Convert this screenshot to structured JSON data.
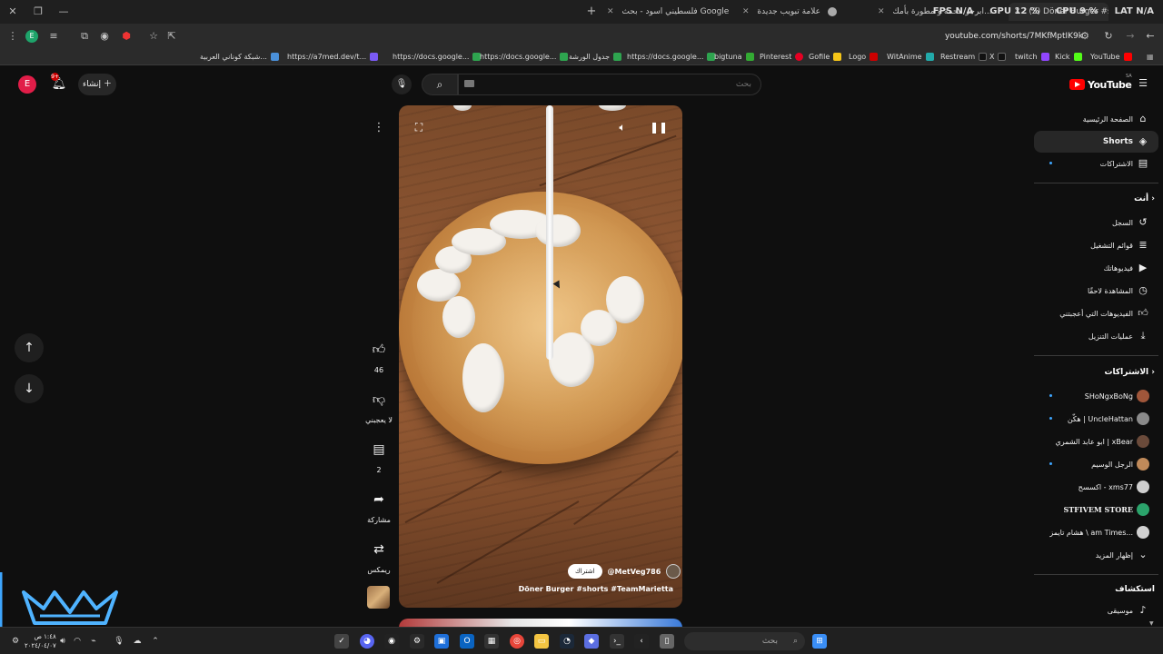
{
  "browser": {
    "tabs": [
      {
        "label": "فلسطيني اسود - بحث Google"
      },
      {
        "label": "علامة تبويب جديدة"
      },
      {
        "label": "ابرجر محمة و مطورة بأمك..."
      },
      {
        "label": "(3) Döner Burger #shorts #..."
      }
    ],
    "stats": {
      "fps": "FPS  N/A",
      "gpu": "GPU  12 %",
      "cpu": "CPU  9 %",
      "lat": "LAT  N/A"
    },
    "url": "youtube.com/shorts/7MKfMptIK9k",
    "bookmarks": [
      {
        "label": "شبكة كوناني العربية...",
        "color": "#4a90d9"
      },
      {
        "label": "https://a7med.dev/t...",
        "color": "#e44"
      },
      {
        "label": "https://docs.google...",
        "color": "#2ea44f"
      },
      {
        "label": "https://docs.google...",
        "color": "#2ea44f"
      },
      {
        "label": "جدول الورشة",
        "color": "#2ea44f"
      },
      {
        "label": "https://docs.google...",
        "color": "#2ea44f"
      },
      {
        "label": "bigtuna",
        "color": "#2ea44f"
      },
      {
        "label": "Pinterest",
        "color": "#9aa"
      },
      {
        "label": "Gofile",
        "color": "#e60023"
      },
      {
        "label": "Logo",
        "color": "#f5c518"
      },
      {
        "label": "WitAnime",
        "color": "#c00"
      },
      {
        "label": "Restream",
        "color": "#2aa"
      },
      {
        "label": "X",
        "color": "#111"
      },
      {
        "label": "twitch",
        "color": "#ddd"
      },
      {
        "label": "Kick",
        "color": "#9146ff"
      },
      {
        "label": "YouTube",
        "color": "#53fc18"
      }
    ]
  },
  "header": {
    "avatar_letter": "E",
    "notification_count": "9+",
    "create_label": "إنشاء",
    "search_placeholder": "بحث",
    "logo_text": "YouTube",
    "logo_region": "SA"
  },
  "sidebar": {
    "main": [
      {
        "label": "الصفحة الرئيسية",
        "icon": "home-icon"
      },
      {
        "label": "Shorts",
        "icon": "shorts-icon"
      },
      {
        "label": "الاشتراكات",
        "icon": "subscriptions-icon"
      }
    ],
    "you_header": "أنت",
    "you": [
      {
        "label": "السجل",
        "icon": "history-icon"
      },
      {
        "label": "قوائم التشغيل",
        "icon": "playlists-icon"
      },
      {
        "label": "فيديوهاتك",
        "icon": "your-videos-icon"
      },
      {
        "label": "المشاهدة لاحقًا",
        "icon": "watch-later-icon"
      },
      {
        "label": "الفيديوهات التي أعجبتني",
        "icon": "liked-icon"
      },
      {
        "label": "عمليات التنزيل",
        "icon": "download-icon"
      }
    ],
    "subs_header": "الاشتراكات",
    "subs": [
      {
        "label": "SHoNgxBoNg",
        "avatar": "#a0563a"
      },
      {
        "label": "هكّن | UncleHattan",
        "avatar": "#8a8a8a"
      },
      {
        "label": "ابو عابد الشمري | xBear",
        "avatar": "#6a4a3a"
      },
      {
        "label": "الرجل الوسيم",
        "avatar": "#c08a5a"
      },
      {
        "label": "اكسسح - xms77",
        "avatar": "#cfcfcf"
      },
      {
        "label": "STFIVEM STORE",
        "avatar": "#2ba36b"
      },
      {
        "label": "هشام تايمز \\ am Times...",
        "avatar": "#d0d0d0"
      },
      {
        "label": "إظهار المزيد",
        "avatar": ""
      }
    ],
    "explore_header": "استكشاف",
    "explore": [
      {
        "label": "موسيقى",
        "icon": "music-icon"
      }
    ]
  },
  "short": {
    "channel": "@MetVeg786",
    "subscribe_label": "اشتراك",
    "title": "Döner Burger #shorts #TeamMarietta",
    "likes": "46",
    "dislike_label": "لا يعجبني",
    "comments": "2",
    "share_label": "مشاركة",
    "remix_label": "ريمكس"
  },
  "taskbar": {
    "search_placeholder": "بحث",
    "time": "١:٤٨ ص",
    "date": "٢٠٢٤/٠٤/٠٧"
  }
}
